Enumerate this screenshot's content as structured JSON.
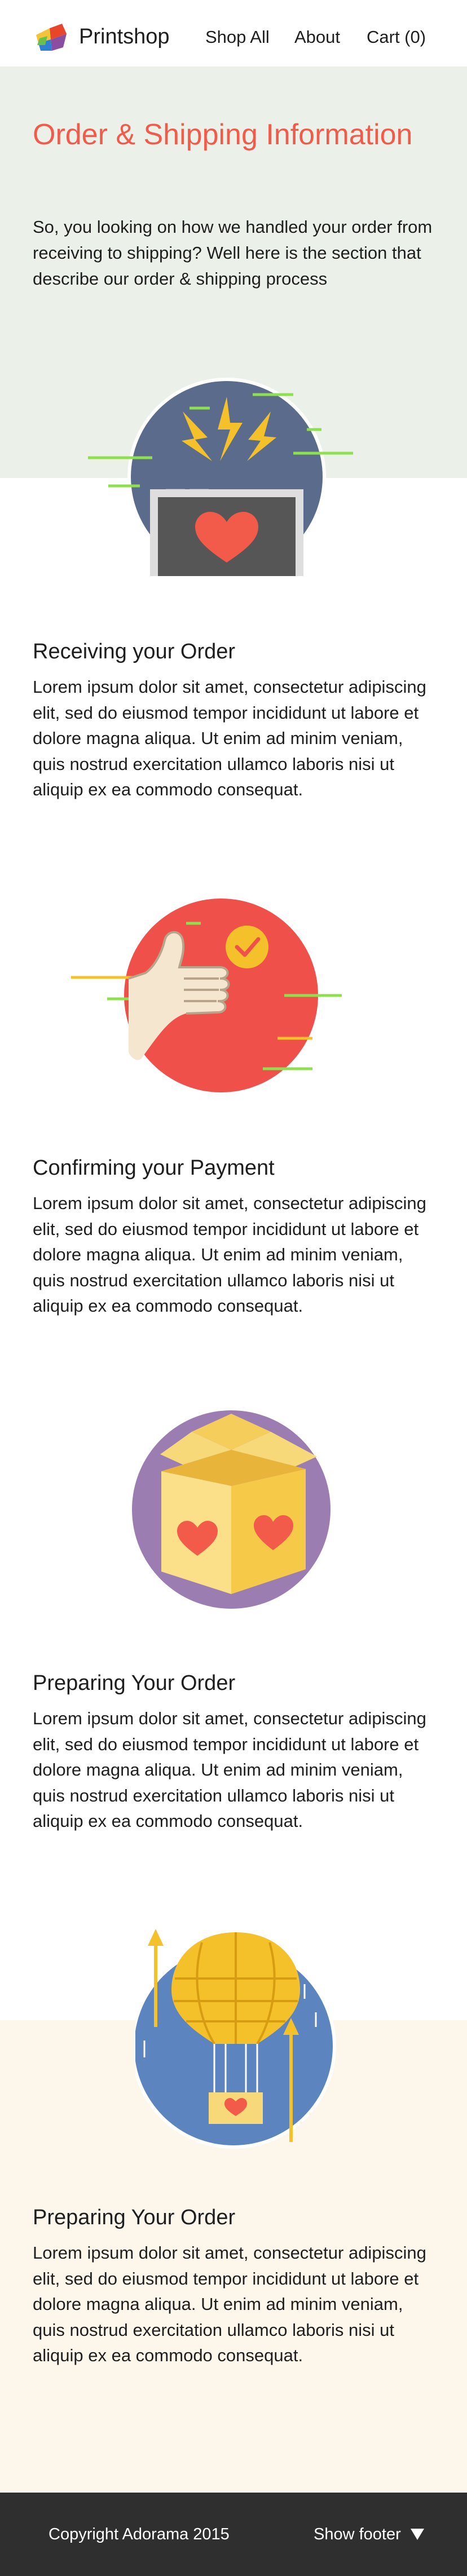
{
  "header": {
    "brand": "Printshop",
    "nav": {
      "shop_all": "Shop All",
      "about": "About",
      "cart": "Cart (0)"
    }
  },
  "hero": {
    "title": "Order & Shipping Information",
    "text": "So, you looking on how we handled your order from receiving to shipping? Well here is the section that describe our order & shipping process"
  },
  "sections": [
    {
      "icon": "charging-heart-laptop-icon",
      "title": "Receiving your Order",
      "body": "Lorem ipsum dolor sit amet, consectetur adipiscing elit, sed do eiusmod tempor incididunt ut labore et dolore magna aliqua. Ut enim ad minim veniam, quis nostrud exercitation ullamco laboris nisi ut aliquip ex ea commodo consequat."
    },
    {
      "icon": "thumbs-up-check-icon",
      "title": "Confirming your Payment",
      "body": "Lorem ipsum dolor sit amet, consectetur adipiscing elit, sed do eiusmod tempor incididunt ut labore et dolore magna aliqua. Ut enim ad minim veniam, quis nostrud exercitation ullamco laboris nisi ut aliquip ex ea commodo consequat."
    },
    {
      "icon": "package-box-icon",
      "title": "Preparing Your Order",
      "body": "Lorem ipsum dolor sit amet, consectetur adipiscing elit, sed do eiusmod tempor incididunt ut labore et dolore magna aliqua. Ut enim ad minim veniam, quis nostrud exercitation ullamco laboris nisi ut aliquip ex ea commodo consequat."
    },
    {
      "icon": "hot-air-balloon-icon",
      "title": "Preparing Your Order",
      "body": "Lorem ipsum dolor sit amet, consectetur adipiscing elit, sed do eiusmod tempor incididunt ut labore et dolore magna aliqua. Ut enim ad minim veniam, quis nostrud exercitation ullamco laboris nisi ut aliquip ex ea commodo consequat."
    }
  ],
  "footer": {
    "copyright": "Copyright Adorama 2015",
    "show_footer": "Show footer",
    "toggle_icon": "caret-down-icon"
  },
  "colors": {
    "accent": "#f25a4a",
    "hero_bg": "#ebf1e8",
    "bottom_band_bg": "#fcf7ea",
    "footer_bg": "#2f2f2f"
  }
}
